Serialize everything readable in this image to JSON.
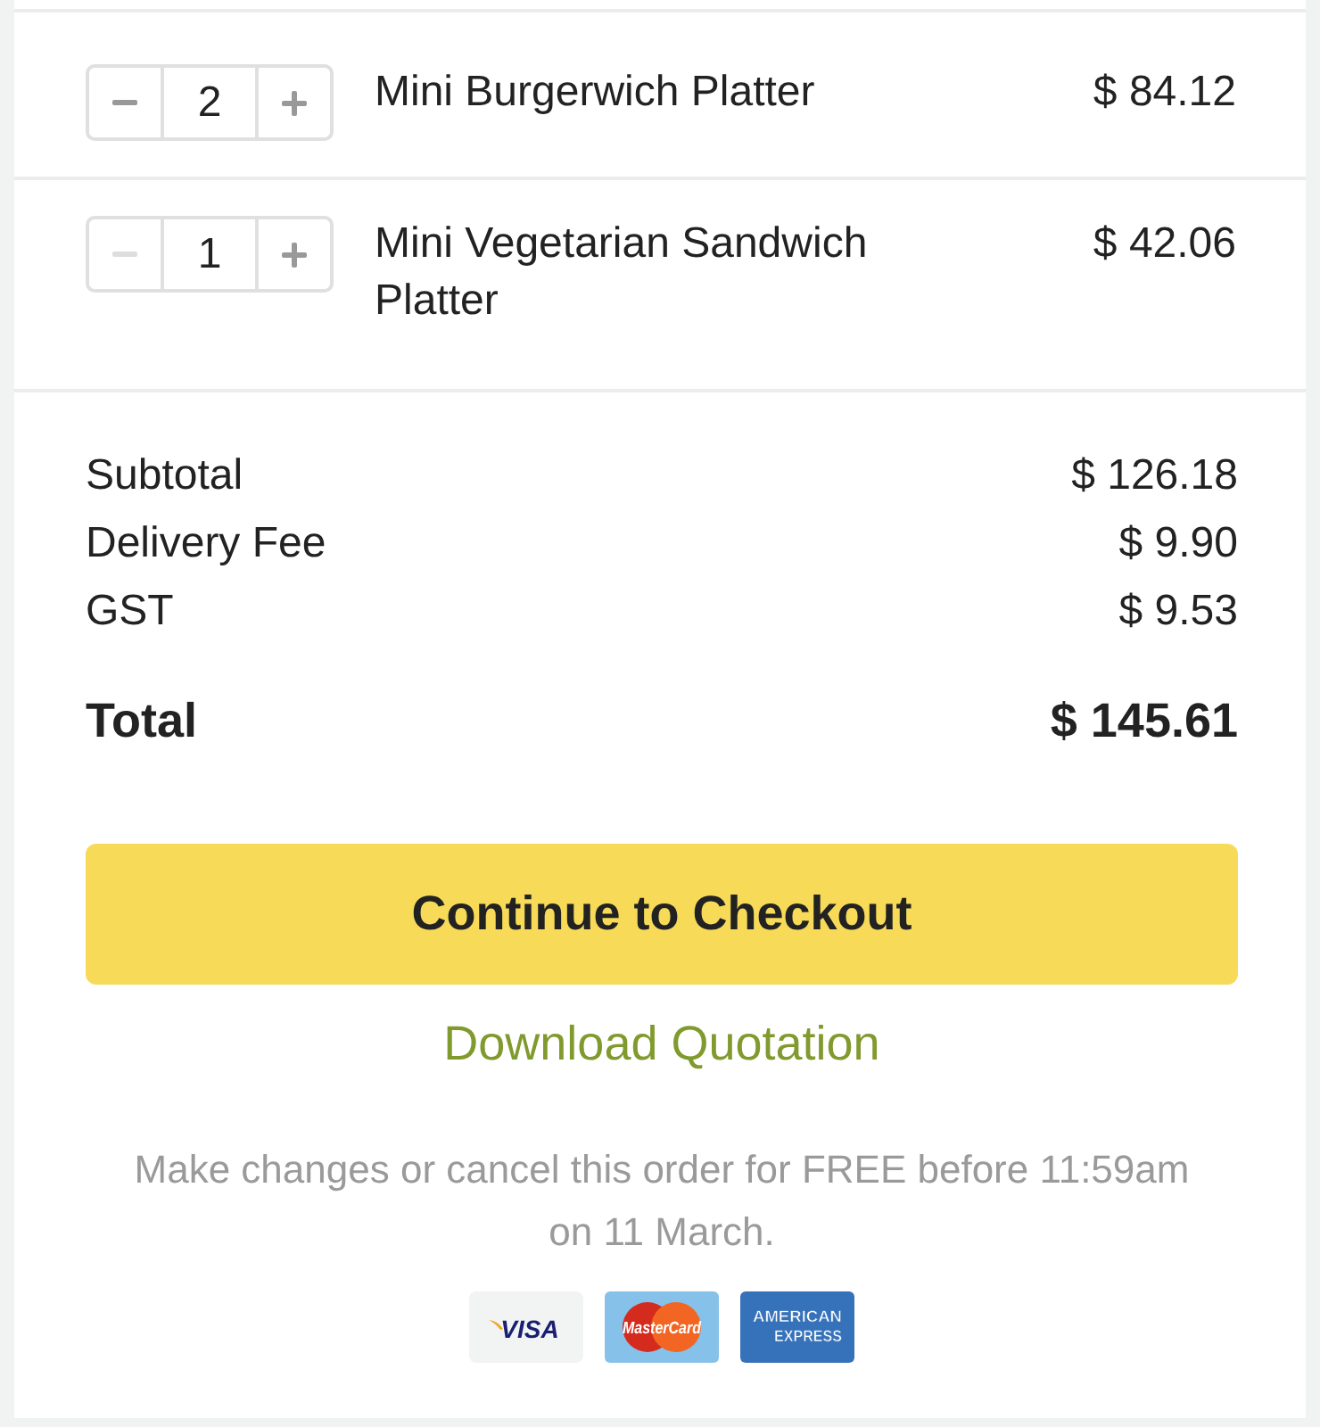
{
  "items": [
    {
      "quantity": "2",
      "name": "Mini Burgerwich Platter",
      "price": "$ 84.12",
      "decrement_disabled": false
    },
    {
      "quantity": "1",
      "name": "Mini Vegetarian Sandwich Platter",
      "price": "$ 42.06",
      "decrement_disabled": true
    }
  ],
  "summary": [
    {
      "label": "Subtotal",
      "value": "$ 126.18"
    },
    {
      "label": "Delivery Fee",
      "value": "$ 9.90"
    },
    {
      "label": "GST",
      "value": "$ 9.53"
    }
  ],
  "total": {
    "label": "Total",
    "value": "$ 145.61"
  },
  "checkout_button": "Continue to Checkout",
  "quotation_link": "Download Quotation",
  "note": "Make changes or cancel this order for FREE before 11:59am on 11 March.",
  "payment_methods": [
    {
      "kind": "visa",
      "lines": [
        "VISA"
      ]
    },
    {
      "kind": "mastercard",
      "lines": [
        "MasterCard"
      ]
    },
    {
      "kind": "amex",
      "lines": [
        "AMERICAN",
        "EXPRESS"
      ]
    }
  ]
}
